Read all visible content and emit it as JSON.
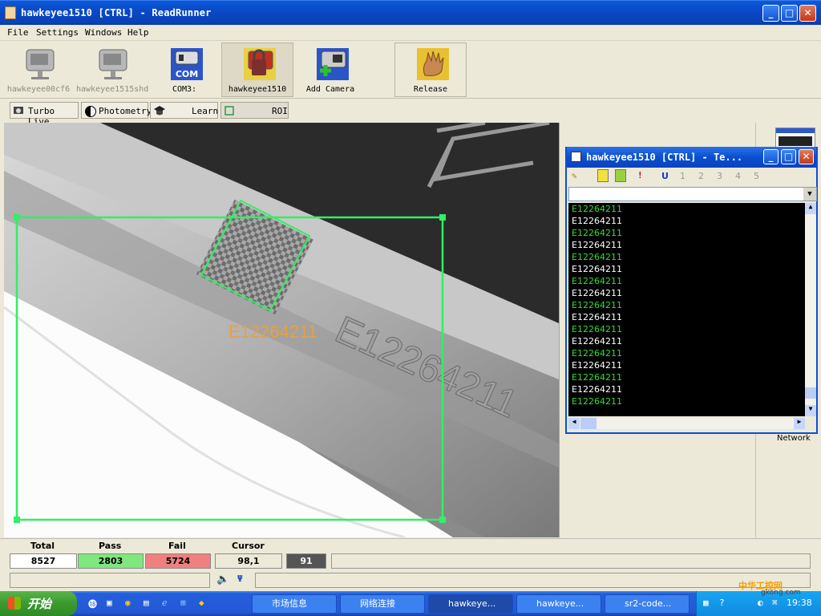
{
  "window": {
    "title": "hawkeyee1510 [CTRL] - ReadRunner"
  },
  "menu": [
    "File",
    "Settings",
    "Windows",
    "Help"
  ],
  "cameras": [
    {
      "label": "hawkeyee00cf6",
      "disabled": true
    },
    {
      "label": "hawkeyee1515shd",
      "disabled": true
    },
    {
      "label": "COM3:",
      "disabled": false,
      "badge": "COM"
    },
    {
      "label": "hawkeyee1510",
      "disabled": false,
      "selected": true
    },
    {
      "label": "Add Camera",
      "disabled": false
    },
    {
      "label": "Release",
      "disabled": false
    }
  ],
  "modes": [
    {
      "label": "Turbo Live"
    },
    {
      "label": "Photometry"
    },
    {
      "label": "Learn"
    },
    {
      "label": "ROI"
    }
  ],
  "image": {
    "decoded_text": "E12264211",
    "embossed_text": "E12264211"
  },
  "terminal": {
    "title": "hawkeyee1510 [CTRL] - Te...",
    "toolbar_numbers": [
      "1",
      "2",
      "3",
      "4",
      "5"
    ],
    "toolbar_u": "U",
    "lines": [
      "E12264211",
      "E12264211",
      "E12264211",
      "E12264211",
      "E12264211",
      "E12264211",
      "E12264211",
      "E12264211",
      "E12264211",
      "E12264211",
      "E12264211",
      "E12264211",
      "E12264211",
      "E12264211",
      "E12264211",
      "E12264211",
      "E12264211"
    ]
  },
  "right_panel": {
    "network_label": "Network"
  },
  "status": {
    "headers": {
      "total": "Total",
      "pass": "Pass",
      "fail": "Fail",
      "cursor": "Cursor"
    },
    "total": "8527",
    "pass": "2803",
    "fail": "5724",
    "cursor": "98,1",
    "extra": "91"
  },
  "taskbar": {
    "start": "开始",
    "tasks": [
      "市场信息",
      "网络连接",
      "hawkeye...",
      "hawkeye...",
      "sr2-code..."
    ],
    "clock": "19:38",
    "watermark": "中华工控网",
    "watermark_url": "gkong.com"
  },
  "colors": {
    "roi": "#33ee66",
    "pass_bg": "#7ee87e",
    "fail_bg": "#f08080",
    "decoded_text": "#e8a040",
    "log_green": "#33dd33"
  }
}
